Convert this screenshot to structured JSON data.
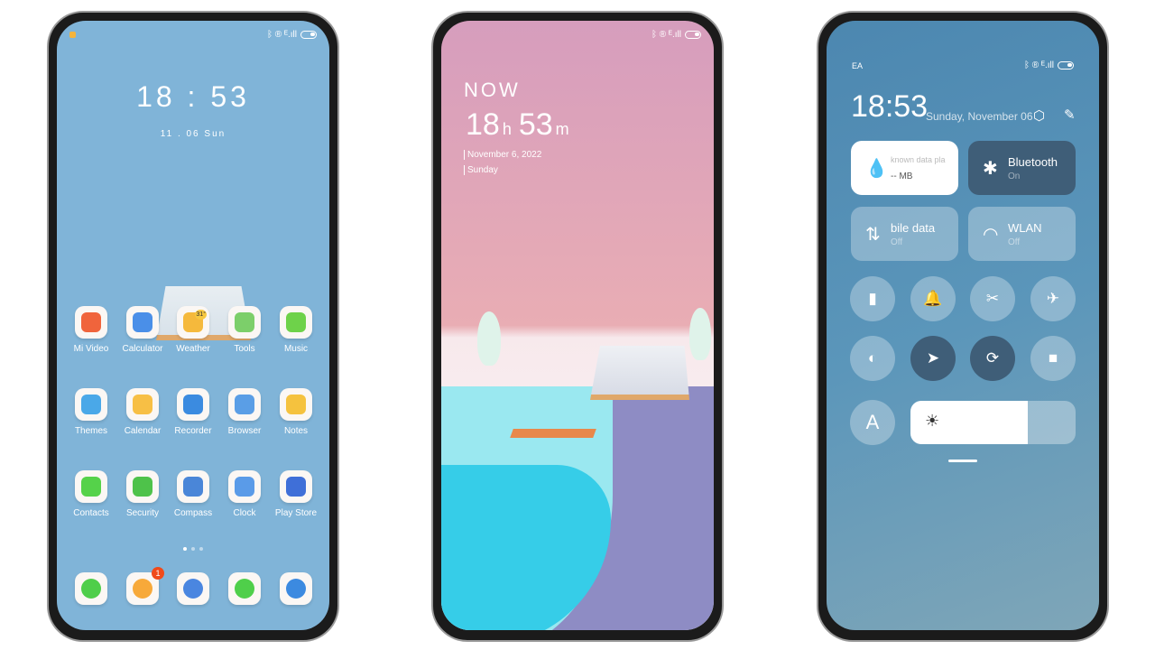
{
  "home": {
    "status_right": "ᛒ ® ᴱ.ıll",
    "clock": "18 : 53",
    "date": "11 . 06  Sun",
    "apps": [
      {
        "label": "Mi Video",
        "color": "#f0643c"
      },
      {
        "label": "Calculator",
        "color": "#4a8fe8"
      },
      {
        "label": "Weather",
        "color": "#f5b93c"
      },
      {
        "label": "Tools",
        "color": "#7ccf6a"
      },
      {
        "label": "Music",
        "color": "#6ed24a"
      },
      {
        "label": "Themes",
        "color": "#4aa8e8"
      },
      {
        "label": "Calendar",
        "color": "#f7bf45"
      },
      {
        "label": "Recorder",
        "color": "#3b8be0"
      },
      {
        "label": "Browser",
        "color": "#5a9ee6"
      },
      {
        "label": "Notes",
        "color": "#f5c23e"
      },
      {
        "label": "Contacts",
        "color": "#55d24a"
      },
      {
        "label": "Security",
        "color": "#4ec24a"
      },
      {
        "label": "Compass",
        "color": "#4a86d8"
      },
      {
        "label": "Clock",
        "color": "#5a9be8"
      },
      {
        "label": "Play Store",
        "color": "#3f6fd8"
      }
    ],
    "weather_temp": "31°",
    "dock": [
      {
        "name": "phone",
        "color": "#4fce4a"
      },
      {
        "name": "messages",
        "color": "#f7a93a",
        "badge": "1"
      },
      {
        "name": "settings",
        "color": "#4a86e0"
      },
      {
        "name": "gallery",
        "color": "#4fcf4a"
      },
      {
        "name": "camera",
        "color": "#3c8ae0"
      }
    ]
  },
  "lock": {
    "status_right": "ᛒ ® ᴱ.ıll",
    "now": "NOW",
    "hours": "18",
    "h": "h",
    "minutes": "53",
    "m": "m",
    "date": "November 6, 2022",
    "day": "Sunday"
  },
  "control": {
    "carrier": "EA",
    "status_right": "ᛒ ® ᴱ.ıll",
    "time": "18:53",
    "date": "Sunday, November 06",
    "tiles": [
      {
        "title": "known data pla",
        "sub": "-- MB",
        "icon": "💧"
      },
      {
        "title": "Bluetooth",
        "sub": "On",
        "icon": "✱"
      },
      {
        "title": "bile data",
        "sub": "Off",
        "icon": "⇅"
      },
      {
        "title": "WLAN",
        "sub": "Off",
        "icon": "◠"
      }
    ],
    "toggles": [
      {
        "name": "flashlight",
        "glyph": "▮",
        "on": false
      },
      {
        "name": "bell",
        "glyph": "🔔",
        "on": false
      },
      {
        "name": "screenshot",
        "glyph": "✂",
        "on": false
      },
      {
        "name": "airplane",
        "glyph": "✈",
        "on": false
      },
      {
        "name": "reading-mode",
        "glyph": "◐",
        "on": false
      },
      {
        "name": "location",
        "glyph": "➤",
        "on": true
      },
      {
        "name": "rotation-lock",
        "glyph": "⟳",
        "on": true
      },
      {
        "name": "video",
        "glyph": "■",
        "on": false
      }
    ],
    "auto_brightness": "A",
    "brightness_percent": 71
  }
}
